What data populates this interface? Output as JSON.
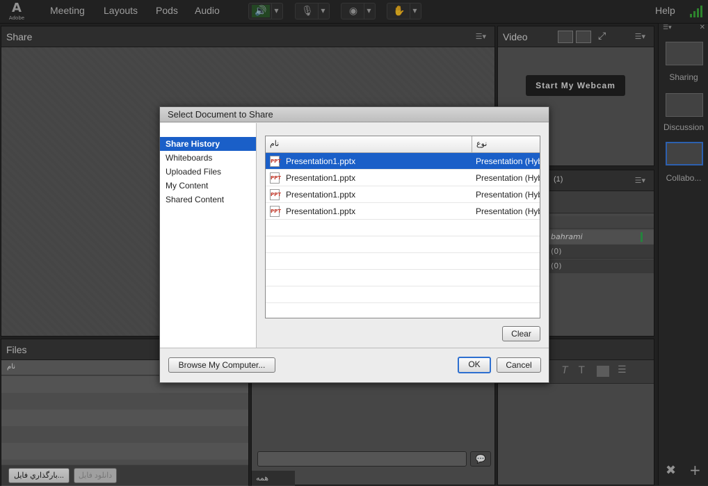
{
  "menubar": {
    "logo_text": "Adobe",
    "items": [
      "Meeting",
      "Layouts",
      "Pods",
      "Audio"
    ],
    "help": "Help",
    "icons": [
      "speaker-icon",
      "microphone-icon",
      "webcam-icon",
      "raise-hand-icon"
    ]
  },
  "pods": {
    "share_title": "Share",
    "video_title": "Video",
    "webcam_button": "Start My Webcam",
    "attendees_count": "(1)",
    "attendee_name": "bahrami",
    "group_a": "(0)",
    "group_b": "(0)",
    "files_title": "Files",
    "files_col": "نام",
    "upload_button": "بارگذاري فايل...",
    "download_button": "دانلود فايل",
    "chat_tab": "همه"
  },
  "layouts": [
    "Sharing",
    "Discussion",
    "Collabo..."
  ],
  "dialog": {
    "title": "Select Document to Share",
    "nav": [
      "Share History",
      "Whiteboards",
      "Uploaded Files",
      "My Content",
      "Shared Content"
    ],
    "columns": [
      "نام",
      "نوع"
    ],
    "rows": [
      {
        "name": "Presentation1.pptx",
        "type": "Presentation (Hyb"
      },
      {
        "name": "Presentation1.pptx",
        "type": "Presentation (Hyb"
      },
      {
        "name": "Presentation1.pptx",
        "type": "Presentation (Hyb"
      },
      {
        "name": "Presentation1.pptx",
        "type": "Presentation (Hyb"
      }
    ],
    "clear_button": "Clear",
    "browse_button": "Browse My Computer...",
    "ok_button": "OK",
    "cancel_button": "Cancel"
  },
  "colors": {
    "selection": "#1a5fc8",
    "accent_green": "#3aa83a"
  }
}
